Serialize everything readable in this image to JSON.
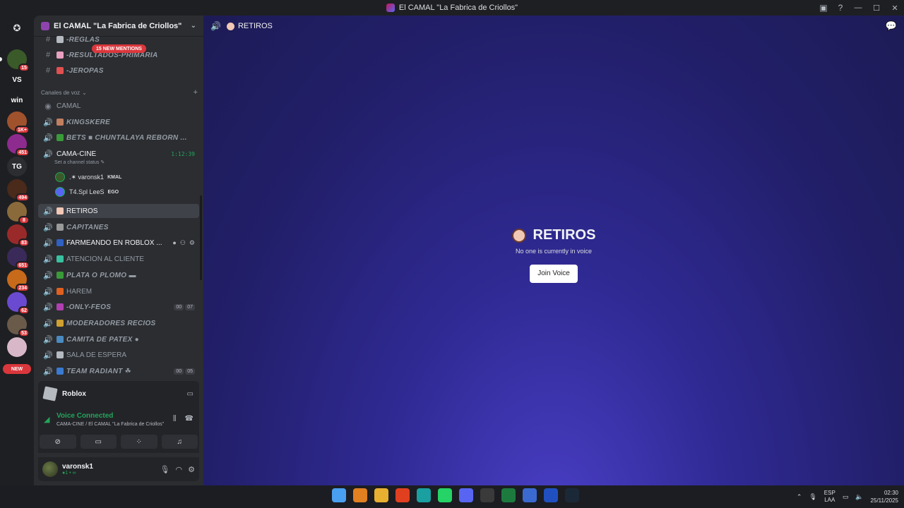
{
  "window": {
    "title": "El CAMAL \"La Fabrica de Criollos\""
  },
  "rail": {
    "items": [
      {
        "label": "",
        "badge": "15",
        "color": "#3a5a2a"
      },
      {
        "label": "VS",
        "badge": "",
        "color": "#1e1f22"
      },
      {
        "label": "win",
        "badge": "",
        "color": "#1e1f22"
      },
      {
        "label": "",
        "badge": "1K+",
        "color": "#a0522d"
      },
      {
        "label": "",
        "badge": "451",
        "color": "#8e2b8e"
      },
      {
        "label": "TG",
        "badge": "",
        "color": "#2b2d31"
      },
      {
        "label": "",
        "badge": "494",
        "color": "#4a2a1a"
      },
      {
        "label": "",
        "badge": "8",
        "color": "#8a6a3a"
      },
      {
        "label": "",
        "badge": "83",
        "color": "#9a2a2a"
      },
      {
        "label": "",
        "badge": "651",
        "color": "#3a2a5a"
      },
      {
        "label": "",
        "badge": "234",
        "color": "#c76a1a"
      },
      {
        "label": "",
        "badge": "62",
        "color": "#6a4ad0"
      },
      {
        "label": "",
        "badge": "53",
        "color": "#6a5a4a"
      },
      {
        "label": "",
        "badge": "",
        "color": "#d8b8c8"
      }
    ],
    "new_label": "NEW"
  },
  "server": {
    "name": "El CAMAL \"La Fabrica de Criollos\""
  },
  "mentions_pill": "15 NEW MENTIONS",
  "text_channels": [
    {
      "name": "-REGLAS",
      "emoji_color": "#b5bac1"
    },
    {
      "name": "-RESULTADOS-PRIMARIA",
      "emoji_color": "#e8a0c0"
    },
    {
      "name": "-JEROPAS",
      "emoji_color": "#e05050"
    }
  ],
  "voice_category": "Canales de voz",
  "voice_channels": [
    {
      "name": "CAMAL",
      "emoji_color": ""
    },
    {
      "name": "KINGSKERE",
      "emoji_color": "#c08060"
    },
    {
      "name": "BETS ■ CHUNTALAYA REBORN ...",
      "emoji_color": "#3a9a3a"
    },
    {
      "name": "CAMA-CINE",
      "emoji_color": "",
      "timer": "1:12:39"
    }
  ],
  "channel_status_placeholder": "Set a channel status",
  "voice_users": [
    {
      "name": ".✶ varonsk1",
      "tag": "KMAL",
      "avatar_color": "#3a5a2a"
    },
    {
      "name": "T4.Spl LeeS",
      "tag": "EGO",
      "avatar_color": "#5865f2"
    }
  ],
  "more_channels": [
    {
      "name": "RETIROS",
      "emoji_color": "#f1c7b5",
      "state": "active"
    },
    {
      "name": "CAPITANES",
      "emoji_color": "#9a9a9a",
      "state": "italic"
    },
    {
      "name": "FARMEANDO EN ROBLOX ...",
      "emoji_color": "#3060c0",
      "state": "hover"
    },
    {
      "name": "ATENCION AL CLIENTE",
      "emoji_color": "#3ac0a0",
      "state": "normal"
    },
    {
      "name": "PLATA O PLOMO ▬",
      "emoji_color": "#3a9a3a",
      "state": "italic"
    },
    {
      "name": "HAREM",
      "emoji_color": "#e06020",
      "state": "normal"
    },
    {
      "name": "-ONLY-FEOS",
      "emoji_color": "#b040b0",
      "state": "italic",
      "counter": [
        "00",
        "07"
      ]
    },
    {
      "name": "MODERADORES RECIOS",
      "emoji_color": "#d0a030",
      "state": "italic"
    },
    {
      "name": "CAMITA DE PATEX ●",
      "emoji_color": "#4a8ac0",
      "state": "italic"
    },
    {
      "name": "SALA DE ESPERA",
      "emoji_color": "#b5bac1",
      "state": "normal"
    },
    {
      "name": "TEAM RADIANT ☘",
      "emoji_color": "#3a7ad0",
      "state": "italic",
      "counter": [
        "00",
        "05"
      ]
    }
  ],
  "activity": {
    "name": "Roblox"
  },
  "voice_connection": {
    "status": "Voice Connected",
    "location": "CAMA-CINE / El CAMAL \"La Fabrica de Criollos\""
  },
  "user": {
    "name": "varonsk1",
    "status": "●1 • ∞"
  },
  "main": {
    "channel_name": "RETIROS",
    "title": "RETIROS",
    "subtitle": "No one is currently in voice",
    "join_label": "Join Voice"
  },
  "taskbar": {
    "apps": [
      {
        "name": "start",
        "color": "#4aa0f0"
      },
      {
        "name": "app-orange",
        "color": "#e08020"
      },
      {
        "name": "explorer",
        "color": "#e8b030"
      },
      {
        "name": "brave",
        "color": "#e04020"
      },
      {
        "name": "edge",
        "color": "#1aa0a0"
      },
      {
        "name": "whatsapp",
        "color": "#25d366"
      },
      {
        "name": "discord",
        "color": "#5865f2"
      },
      {
        "name": "app-circle",
        "color": "#3a3a3a"
      },
      {
        "name": "excel",
        "color": "#1d7a3f"
      },
      {
        "name": "notepad",
        "color": "#3a6ad0"
      },
      {
        "name": "roblox",
        "color": "#2050c0"
      },
      {
        "name": "steam",
        "color": "#1b2838"
      }
    ],
    "lang_top": "ESP",
    "lang_bottom": "LAA",
    "time": "02:30",
    "date": "25/11/2025"
  }
}
